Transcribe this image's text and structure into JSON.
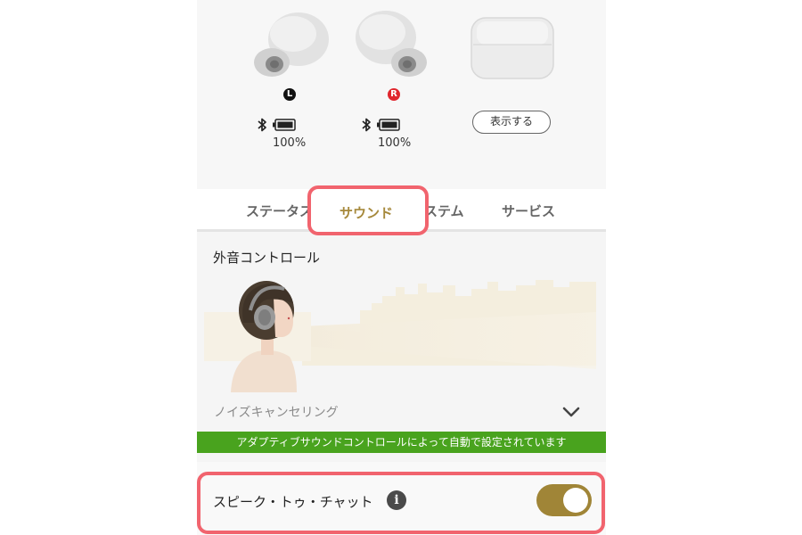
{
  "device": {
    "left_indicator": "L",
    "right_indicator": "R",
    "left_battery": "100%",
    "right_battery": "100%",
    "case_button": "表示する"
  },
  "tabs": [
    {
      "label": "ステータス",
      "active": false
    },
    {
      "label": "サウンド",
      "active": true
    },
    {
      "label": "システム",
      "active": false
    },
    {
      "label": "サービス",
      "active": false
    }
  ],
  "ambient": {
    "title": "外音コントロール",
    "mode": "ノイズキャンセリング",
    "banner": "アダプティブサウンドコントロールによって自動で設定されています"
  },
  "speak_to_chat": {
    "label": "スピーク・トゥ・チャット",
    "info_icon": "i",
    "enabled": true
  },
  "colors": {
    "accent": "#a6893c",
    "highlight": "#f1646e",
    "banner": "#49a31e",
    "toggle_on": "#a08537"
  }
}
